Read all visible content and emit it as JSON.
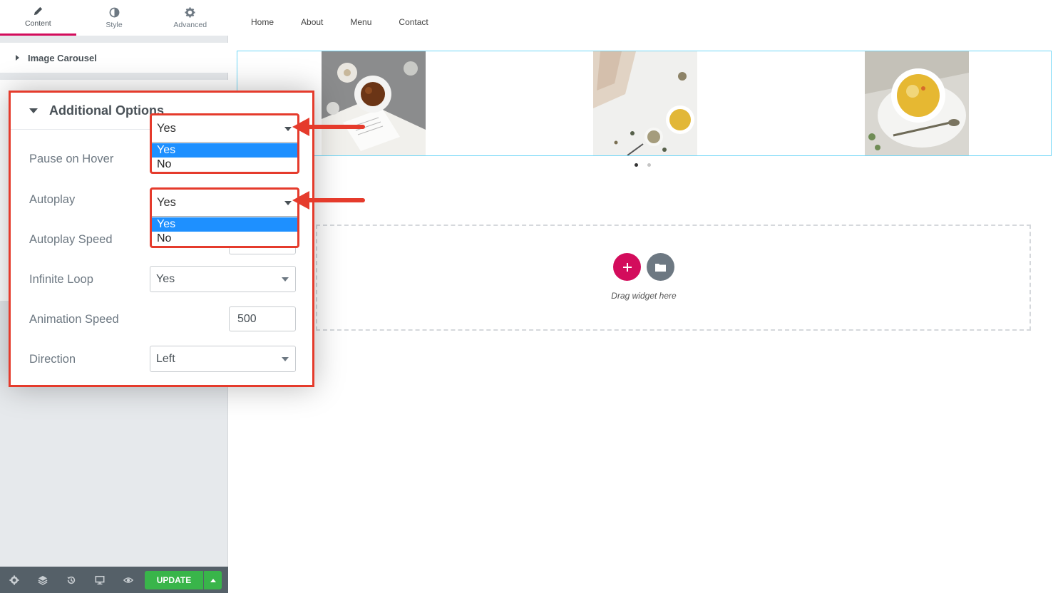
{
  "panel": {
    "tabs": [
      {
        "label": "Content",
        "icon": "pencil-icon"
      },
      {
        "label": "Style",
        "icon": "half-circle-icon"
      },
      {
        "label": "Advanced",
        "icon": "gear-icon"
      }
    ],
    "section_title": "Image Carousel"
  },
  "options": {
    "title": "Additional Options",
    "pause_on_hover": {
      "label": "Pause on Hover",
      "value": "Yes",
      "options": [
        "Yes",
        "No"
      ]
    },
    "autoplay": {
      "label": "Autoplay",
      "value": "Yes",
      "options": [
        "Yes",
        "No"
      ]
    },
    "autoplay_speed": {
      "label": "Autoplay Speed"
    },
    "infinite_loop": {
      "label": "Infinite Loop",
      "value": "Yes"
    },
    "animation_speed": {
      "label": "Animation Speed",
      "value": "500"
    },
    "direction": {
      "label": "Direction",
      "value": "Left"
    }
  },
  "toolbar": {
    "update_label": "UPDATE",
    "icons": [
      "settings-icon",
      "layers-icon",
      "history-icon",
      "responsive-icon",
      "preview-icon"
    ]
  },
  "canvas": {
    "nav": [
      "Home",
      "About",
      "Menu",
      "Contact"
    ],
    "drag_text": "Drag widget here",
    "carousel_pages": 2,
    "active_page": 1
  },
  "colors": {
    "accent": "#d30c5c",
    "highlight": "#e53b2c",
    "update_green": "#39b54a",
    "dropdown_selected": "#1e90ff"
  }
}
